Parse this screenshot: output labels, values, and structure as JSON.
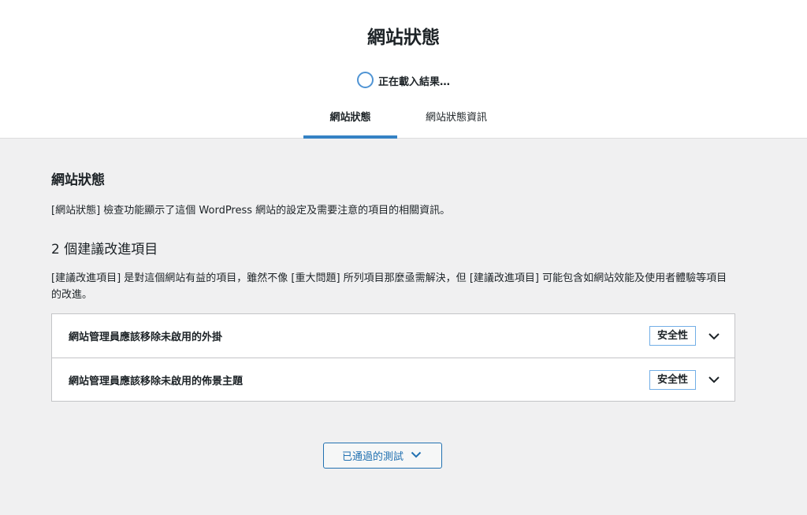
{
  "header": {
    "title": "網站狀態",
    "progress_text": "正在載入結果…"
  },
  "tabs": [
    {
      "label": "網站狀態",
      "active": true
    },
    {
      "label": "網站狀態資訊",
      "active": false
    }
  ],
  "main": {
    "section_title": "網站狀態",
    "description": "[網站狀態] 檢查功能顯示了這個 WordPress 網站的設定及需要注意的項目的相關資訊。",
    "issues_heading": "2 個建議改進項目",
    "issues_description": "[建議改進項目] 是對這個網站有益的項目，雖然不像 [重大問題] 所列項目那麼亟需解決，但 [建議改進項目] 可能包含如網站效能及使用者體驗等項目的改進。",
    "issues": [
      {
        "title": "網站管理員應該移除未啟用的外掛",
        "badge": "安全性"
      },
      {
        "title": "網站管理員應該移除未啟用的佈景主題",
        "badge": "安全性"
      }
    ],
    "passed_button": "已通過的測試"
  },
  "colors": {
    "accent": "#3582c4",
    "button_text": "#2271b1",
    "badge_border": "#72aee6",
    "background": "#f0f0f1"
  },
  "icons": {
    "progress": "loading-circle-icon",
    "expand": "chevron-down-icon"
  }
}
